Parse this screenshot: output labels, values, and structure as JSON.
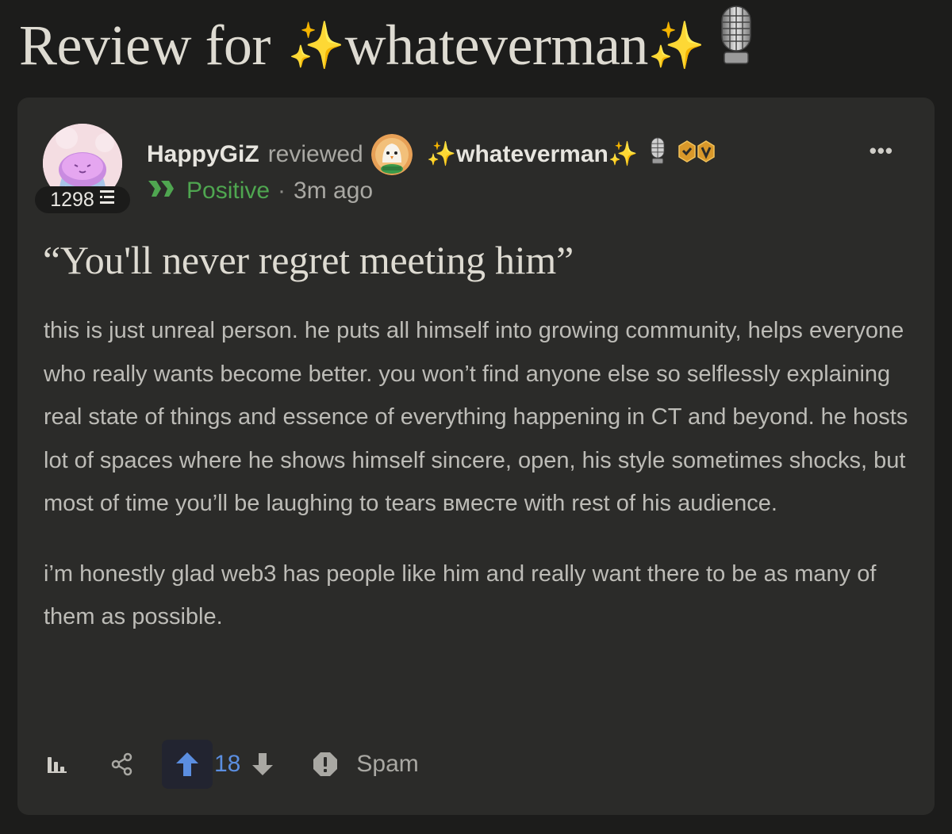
{
  "page": {
    "title_prefix": "Review for",
    "title_name": "whateverman",
    "sparkle_glyph": "✨"
  },
  "review": {
    "reviewer": {
      "name": "HappyGiZ",
      "score": "1298",
      "avatar_icon": "blob-avatar-icon"
    },
    "reviewed_word": "reviewed",
    "target": {
      "name": "whateverman",
      "avatar_icon": "bird-avatar-icon",
      "badge_icon": "verified-badge-icon"
    },
    "sentiment": "Positive",
    "sentiment_color": "#4fa650",
    "separator": "·",
    "time_ago": "3m ago",
    "more_label": "•••",
    "title": "“You'll never regret meeting him”",
    "paragraphs": [
      "this is just unreal person. he puts all himself into growing community, helps everyone who really wants become better. you won’t find anyone else so selflessly explaining real state of things and essence of everything happening in CT and beyond. he hosts lot of spaces where he shows himself sincere, open, his style sometimes shocks, but most of time you’ll be laughing to tears вместе with rest of his audience.",
      "i’m honestly glad web3 has people like him and really want there to be as many of them as possible."
    ]
  },
  "actions": {
    "vote_count": "18",
    "spam_label": "Spam",
    "upvote_color": "#5b8ee0"
  }
}
